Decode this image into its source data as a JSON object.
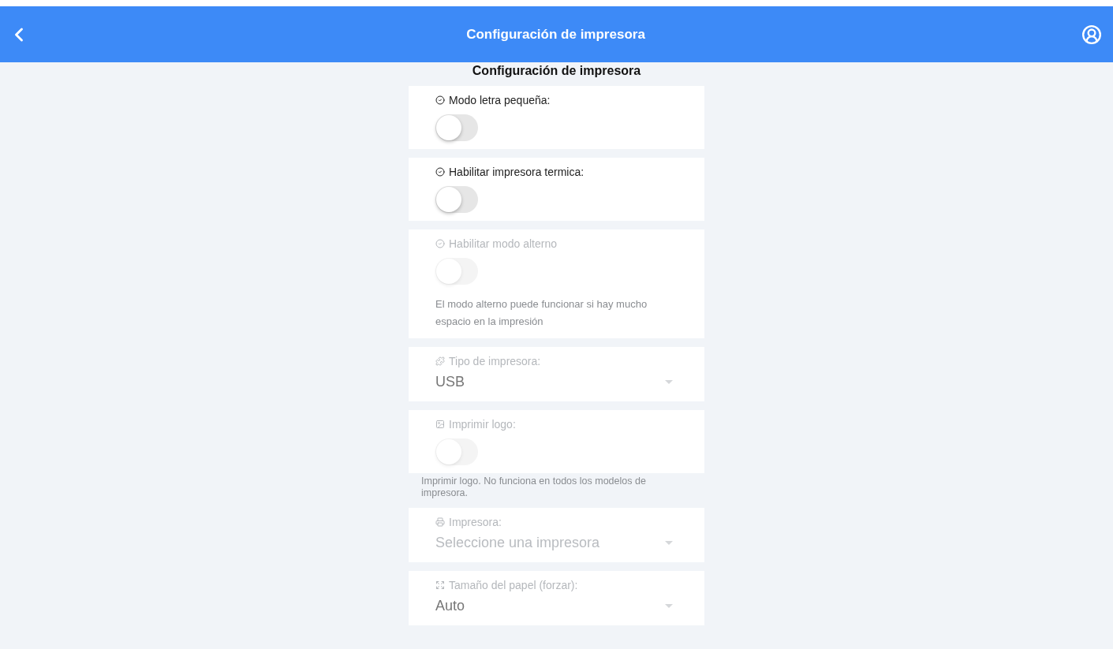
{
  "header": {
    "title": "Configuración de impresora"
  },
  "page_heading": "Configuración de impresora",
  "settings": [
    {
      "kind": "toggle",
      "label": "Modo letra pequeña:",
      "on": false,
      "disabled": false
    },
    {
      "kind": "toggle",
      "label": "Habilitar impresora termica:",
      "on": false,
      "disabled": false
    },
    {
      "kind": "toggle",
      "label": "Habilitar modo alterno",
      "on": false,
      "disabled": true,
      "hint": "El modo alterno puede funcionar si hay mucho espacio en la impresión"
    },
    {
      "kind": "select",
      "label": "Tipo de impresora:",
      "value": "USB",
      "disabled": true
    },
    {
      "kind": "toggle",
      "label": "Imprimir logo:",
      "on": false,
      "disabled": true,
      "note": "Imprimir logo. No funciona en todos los modelos de impresora."
    },
    {
      "kind": "select",
      "label": "Impresora:",
      "placeholder": "Seleccione una impresora",
      "disabled": true
    },
    {
      "kind": "select",
      "label": "Tamaño del papel (forzar):",
      "value": "Auto",
      "disabled": true
    }
  ]
}
